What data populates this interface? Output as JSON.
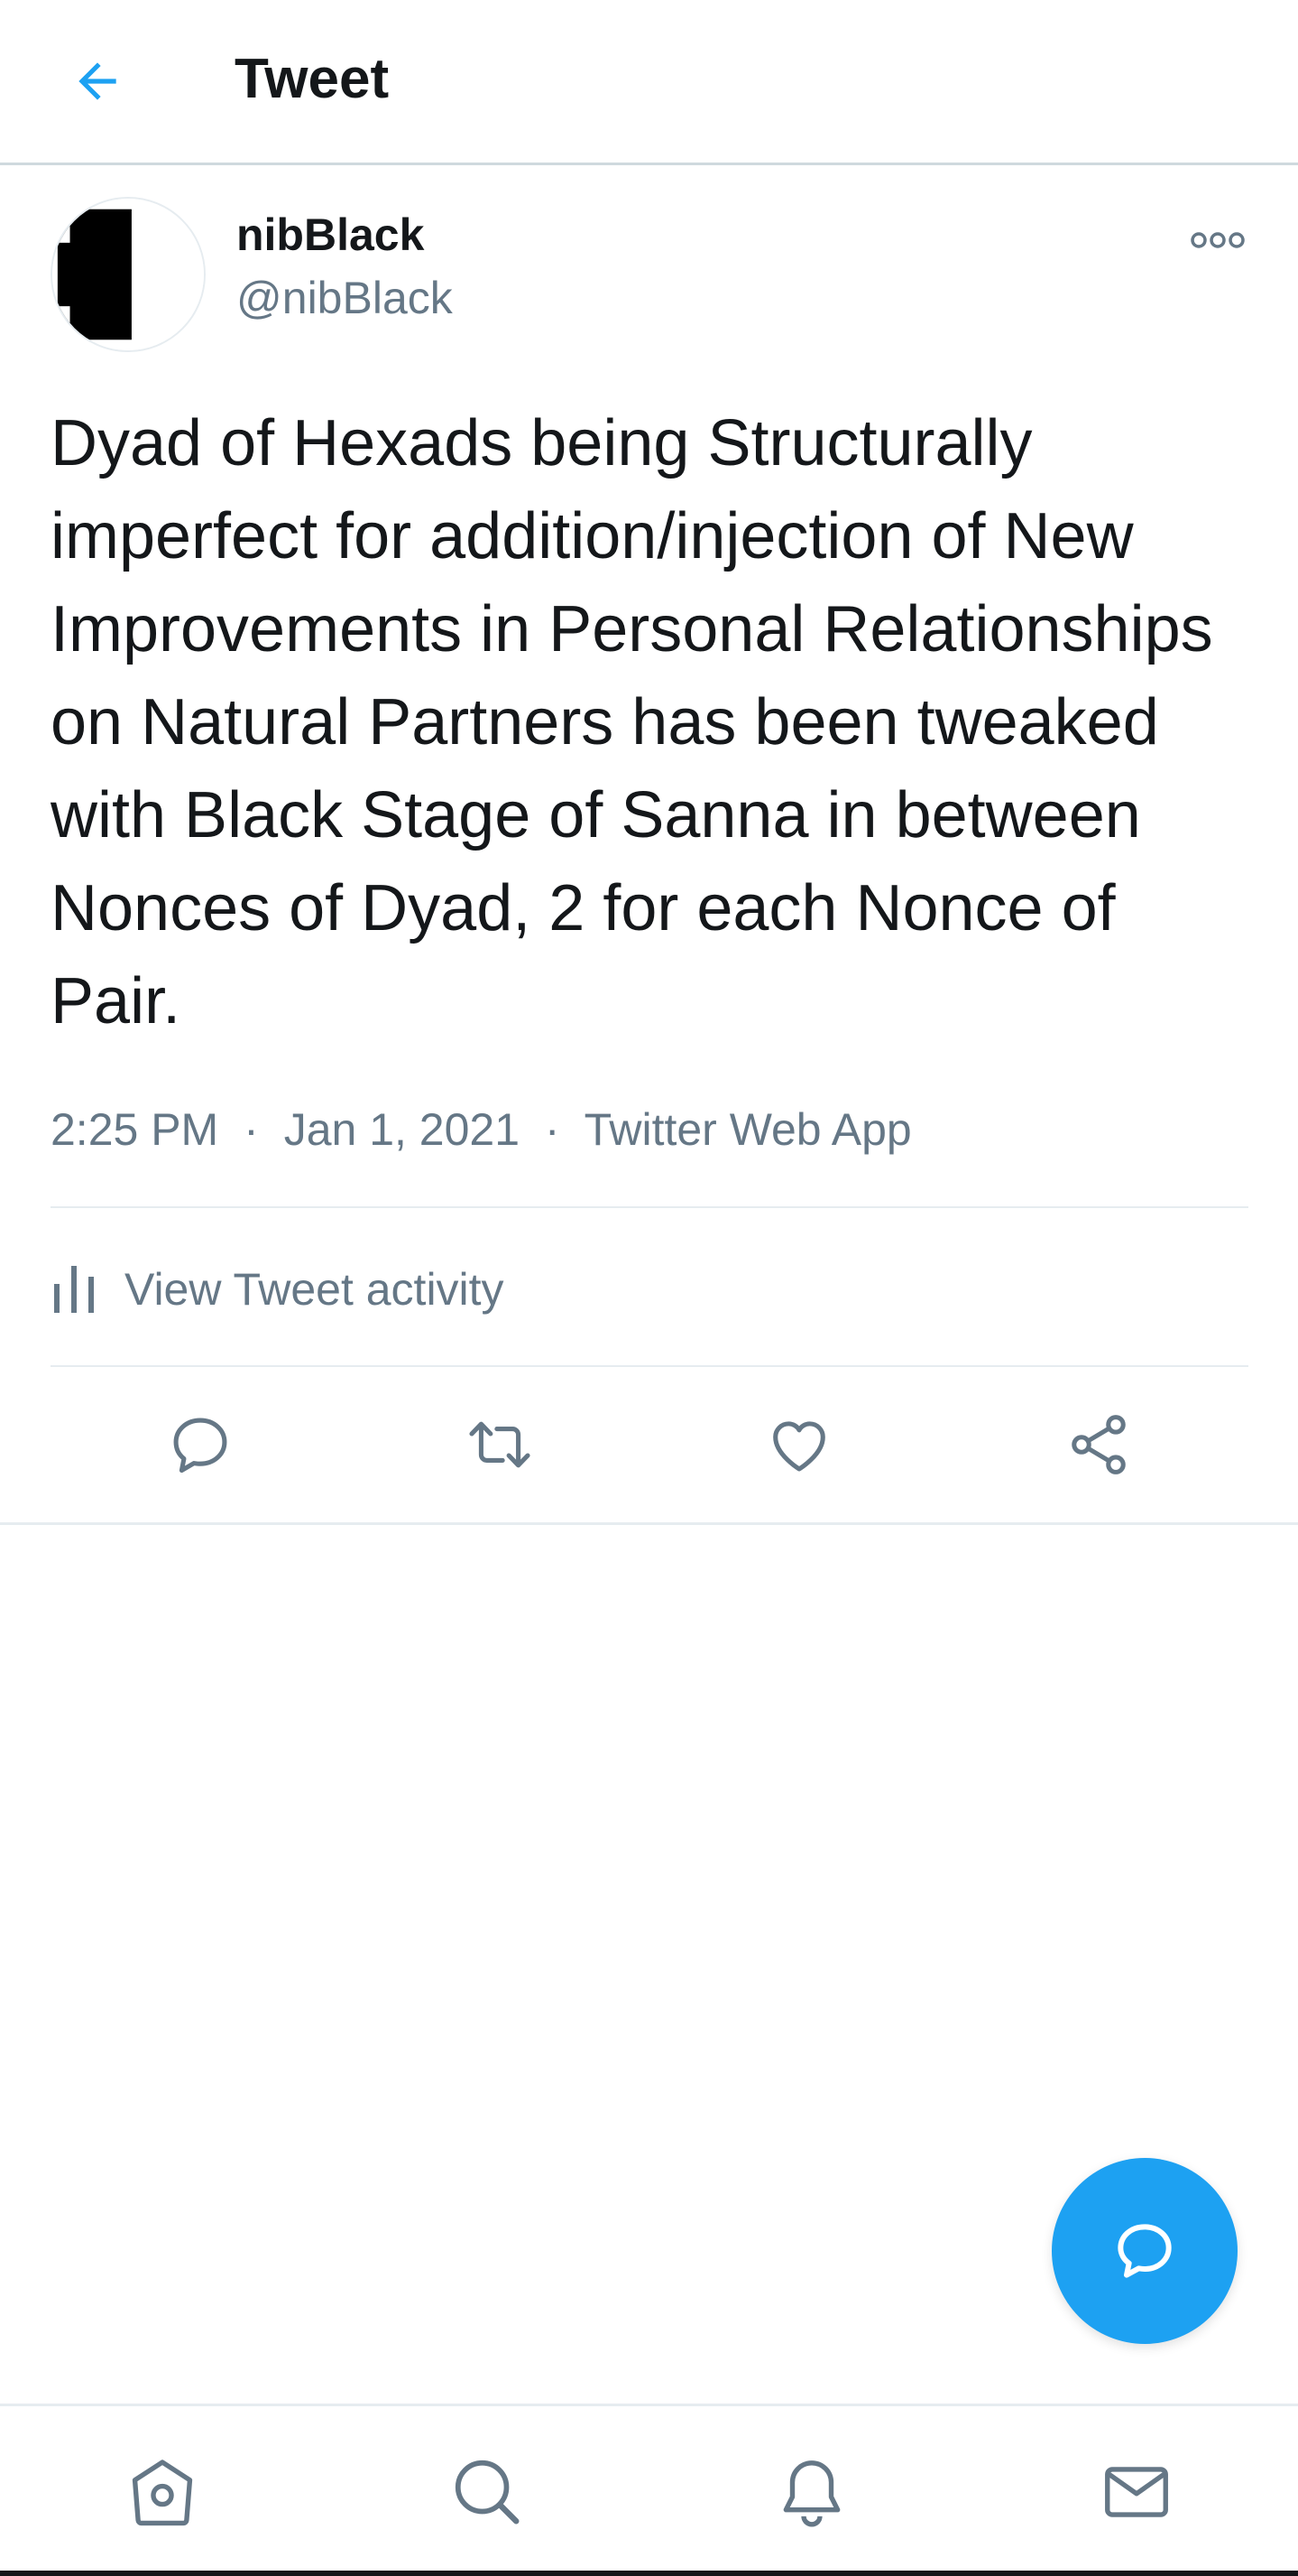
{
  "header": {
    "title": "Tweet",
    "back_icon": "arrow-left-icon"
  },
  "colors": {
    "accent": "#1da1f2",
    "secondary_text": "#657786",
    "primary_text": "#14171a",
    "divider": "#e6ecf0"
  },
  "tweet": {
    "author": {
      "display_name": "nibBlack",
      "handle": "@nibBlack",
      "avatar_icon": "avatar-black-bar"
    },
    "more_icon": "more-options-icon",
    "text": "Dyad of Hexads being Structurally imperfect for addition/injection of New Improvements in Personal Relationships on Natural Partners has been tweaked with Black Stage of Sanna in between Nonces of Dyad, 2 for each Nonce of Pair.",
    "time": "2:25 PM",
    "date": "Jan 1, 2021",
    "separator": "·",
    "source": "Twitter Web App"
  },
  "activity": {
    "label": "View Tweet activity",
    "icon": "bar-chart-icon"
  },
  "actions": [
    {
      "name": "reply",
      "icon": "reply-icon"
    },
    {
      "name": "retweet",
      "icon": "retweet-icon"
    },
    {
      "name": "like",
      "icon": "heart-icon"
    },
    {
      "name": "share",
      "icon": "share-icon"
    }
  ],
  "fab": {
    "icon": "compose-reply-icon"
  },
  "bottom_nav": [
    {
      "name": "home",
      "icon": "home-icon"
    },
    {
      "name": "search",
      "icon": "search-icon"
    },
    {
      "name": "notifications",
      "icon": "bell-icon"
    },
    {
      "name": "messages",
      "icon": "mail-icon"
    }
  ]
}
